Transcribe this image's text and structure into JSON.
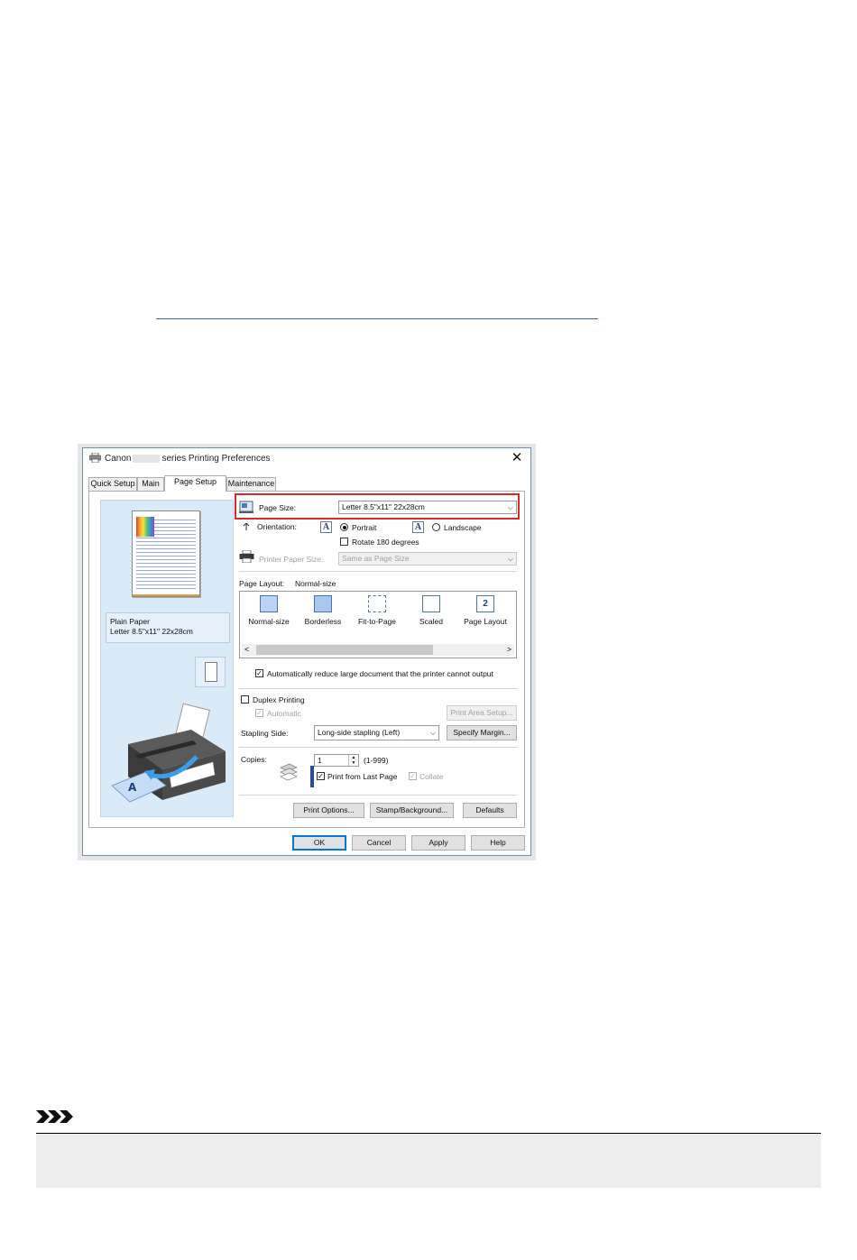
{
  "dialog": {
    "title_prefix": "Canon",
    "title_suffix": "series Printing Preferences",
    "close_symbol": "✕",
    "tabs": [
      {
        "label": "Quick Setup"
      },
      {
        "label": "Main"
      },
      {
        "label": "Page Setup"
      },
      {
        "label": "Maintenance"
      }
    ],
    "preview": {
      "media_type": "Plain Paper",
      "paper_size": "Letter 8.5\"x11\" 22x28cm"
    },
    "page_size": {
      "label": "Page Size:",
      "value": "Letter 8.5\"x11\" 22x28cm"
    },
    "orientation": {
      "label": "Orientation:",
      "portrait": "Portrait",
      "landscape": "Landscape",
      "rotate": "Rotate 180 degrees",
      "selected": "portrait"
    },
    "printer_paper_size": {
      "label": "Printer Paper Size:",
      "value": "Same as Page Size"
    },
    "page_layout": {
      "label": "Page Layout:",
      "value": "Normal-size",
      "items": [
        {
          "label": "Normal-size"
        },
        {
          "label": "Borderless"
        },
        {
          "label": "Fit-to-Page"
        },
        {
          "label": "Scaled"
        },
        {
          "label": "Page Layout"
        }
      ],
      "page_layout_glyph": "2"
    },
    "auto_reduce": {
      "label": "Automatically reduce large document that the printer cannot output",
      "checked": true
    },
    "duplex": {
      "label": "Duplex Printing",
      "automatic": "Automatic",
      "print_area_button": "Print Area Setup..."
    },
    "stapling": {
      "label": "Stapling Side:",
      "value": "Long-side stapling (Left)",
      "margin_button": "Specify Margin..."
    },
    "copies": {
      "label": "Copies:",
      "value": "1",
      "range": "(1-999)",
      "print_from_last": "Print from Last Page",
      "collate": "Collate"
    },
    "panel_buttons": {
      "print_options": "Print Options...",
      "stamp": "Stamp/Background...",
      "defaults": "Defaults"
    },
    "footer_buttons": {
      "ok": "OK",
      "cancel": "Cancel",
      "apply": "Apply",
      "help": "Help"
    },
    "colors": {
      "highlight": "#d92b2b",
      "preview_bg": "#d9ebf9"
    }
  }
}
